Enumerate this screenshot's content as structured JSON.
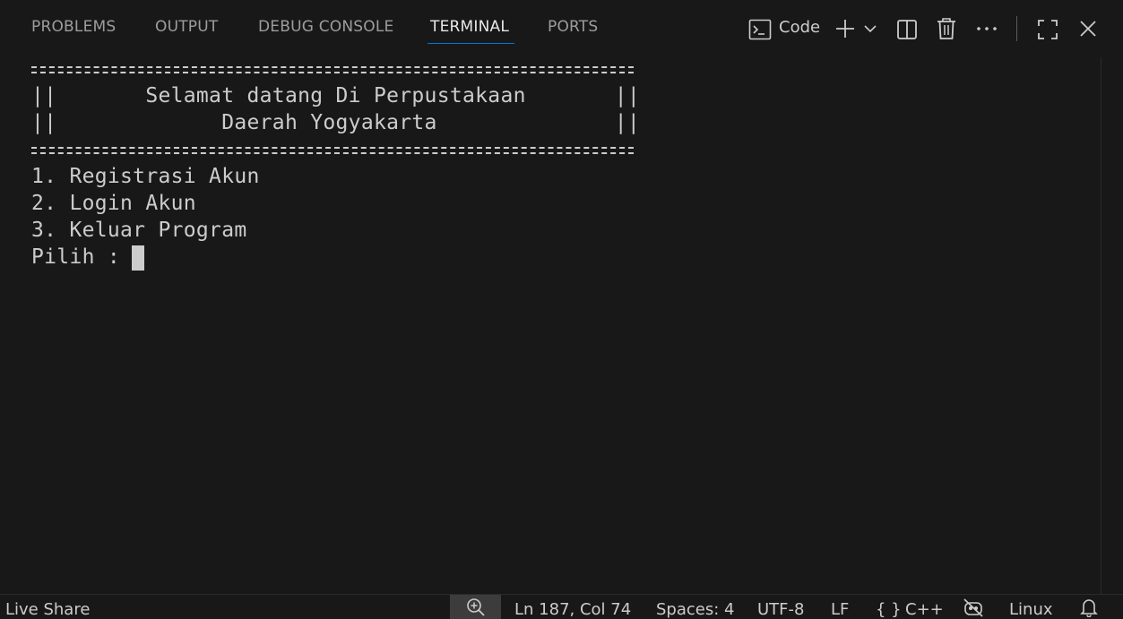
{
  "tabs": [
    {
      "label": "PROBLEMS"
    },
    {
      "label": "OUTPUT"
    },
    {
      "label": "DEBUG CONSOLE"
    },
    {
      "label": "TERMINAL"
    },
    {
      "label": "PORTS"
    }
  ],
  "active_tab": "TERMINAL",
  "toolbar": {
    "terminal_profile_label": "Code",
    "icons": [
      "terminal-icon",
      "plus-icon",
      "chevron-down-icon",
      "split-icon",
      "trash-icon",
      "ellipsis-icon",
      "maximize-icon",
      "close-icon"
    ]
  },
  "terminal": {
    "lines": [
      "||       Selamat datang Di Perpustakaan       ||",
      "||             Daerah Yogyakarta              ||",
      "1. Registrasi Akun",
      "2. Login Akun",
      "3. Keluar Program",
      "Pilih : "
    ]
  },
  "statusbar": {
    "live_share": "Live Share",
    "position": "Ln 187, Col 74",
    "spaces": "Spaces: 4",
    "encoding": "UTF-8",
    "eol": "LF",
    "language": "C++",
    "language_icon": "{ }",
    "os": "Linux"
  },
  "colors": {
    "background": "#181818",
    "accent": "#0078d4",
    "text": "#cccccc"
  }
}
